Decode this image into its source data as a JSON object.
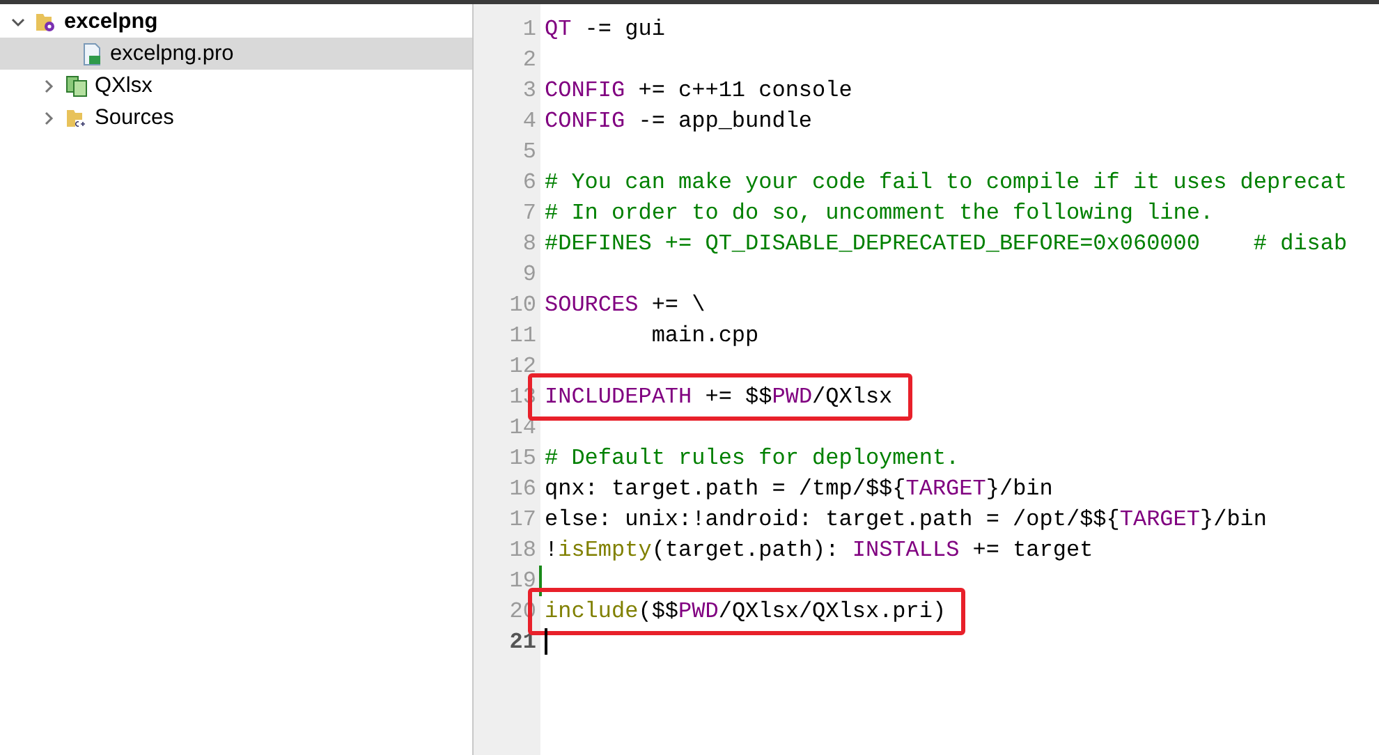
{
  "project_tree": [
    {
      "label": "excelpng",
      "kind": "project",
      "expanded": true,
      "selected": false,
      "children": [
        {
          "label": "excelpng.pro",
          "kind": "profile",
          "selected": true
        },
        {
          "label": "QXlsx",
          "kind": "subproject",
          "expanded": false,
          "selected": false
        },
        {
          "label": "Sources",
          "kind": "sources",
          "expanded": false,
          "selected": false
        }
      ]
    }
  ],
  "editor": {
    "lines": [
      {
        "number": "1",
        "tokens": [
          {
            "kind": "keyword",
            "text": "QT"
          },
          {
            "kind": "plain",
            "text": " -= gui"
          }
        ]
      },
      {
        "number": "2"
      },
      {
        "number": "3",
        "tokens": [
          {
            "kind": "keyword",
            "text": "CONFIG"
          },
          {
            "kind": "plain",
            "text": " += c++11 console"
          }
        ]
      },
      {
        "number": "4",
        "tokens": [
          {
            "kind": "keyword",
            "text": "CONFIG"
          },
          {
            "kind": "plain",
            "text": " -= app_bundle"
          }
        ]
      },
      {
        "number": "5"
      },
      {
        "number": "6",
        "tokens": [
          {
            "kind": "comment",
            "text": "# You can make your code fail to compile if it uses deprecat"
          }
        ]
      },
      {
        "number": "7",
        "tokens": [
          {
            "kind": "comment",
            "text": "# In order to do so, uncomment the following line."
          }
        ]
      },
      {
        "number": "8",
        "tokens": [
          {
            "kind": "comment",
            "text": "#DEFINES += QT_DISABLE_DEPRECATED_BEFORE=0x060000    # disab"
          }
        ]
      },
      {
        "number": "9"
      },
      {
        "number": "10",
        "tokens": [
          {
            "kind": "keyword",
            "text": "SOURCES"
          },
          {
            "kind": "plain",
            "text": " += \\"
          }
        ]
      },
      {
        "number": "11",
        "tokens": [
          {
            "kind": "plain",
            "text": "        main.cpp"
          }
        ]
      },
      {
        "number": "12"
      },
      {
        "number": "13",
        "highlighted": true,
        "tokens": [
          {
            "kind": "keyword",
            "text": "INCLUDEPATH"
          },
          {
            "kind": "plain",
            "text": " += $$"
          },
          {
            "kind": "keyword",
            "text": "PWD"
          },
          {
            "kind": "plain",
            "text": "/QXlsx"
          }
        ]
      },
      {
        "number": "14"
      },
      {
        "number": "15",
        "tokens": [
          {
            "kind": "comment",
            "text": "# Default rules for deployment."
          }
        ]
      },
      {
        "number": "16",
        "tokens": [
          {
            "kind": "plain",
            "text": "qnx: target.path = /tmp/$${"
          },
          {
            "kind": "keyword",
            "text": "TARGET"
          },
          {
            "kind": "plain",
            "text": "}/bin"
          }
        ]
      },
      {
        "number": "17",
        "tokens": [
          {
            "kind": "plain",
            "text": "else: unix:!android: target.path = /opt/$${"
          },
          {
            "kind": "keyword",
            "text": "TARGET"
          },
          {
            "kind": "plain",
            "text": "}/bin"
          }
        ]
      },
      {
        "number": "18",
        "tokens": [
          {
            "kind": "plain",
            "text": "!"
          },
          {
            "kind": "function",
            "text": "isEmpty"
          },
          {
            "kind": "plain",
            "text": "(target.path): "
          },
          {
            "kind": "keyword",
            "text": "INSTALLS"
          },
          {
            "kind": "plain",
            "text": " += target"
          }
        ]
      },
      {
        "number": "19",
        "changed": true
      },
      {
        "number": "20",
        "highlighted": true,
        "tokens": [
          {
            "kind": "function",
            "text": "include"
          },
          {
            "kind": "plain",
            "text": "($$"
          },
          {
            "kind": "keyword",
            "text": "PWD"
          },
          {
            "kind": "plain",
            "text": "/QXlsx/QXlsx.pri)"
          }
        ]
      },
      {
        "number": "21",
        "current": true
      }
    ]
  }
}
